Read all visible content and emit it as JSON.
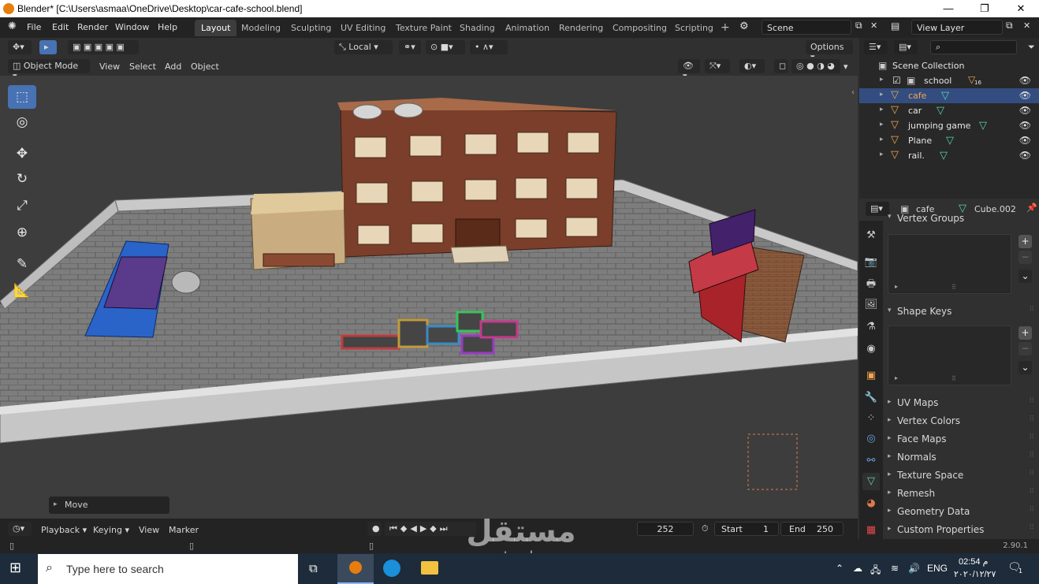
{
  "window": {
    "title": "Blender* [C:\\Users\\asmaa\\OneDrive\\Desktop\\car-cafe-school.blend]",
    "minimize": "—",
    "restore": "❐",
    "close": "✕"
  },
  "menu": {
    "items": [
      "File",
      "Edit",
      "Render",
      "Window",
      "Help"
    ]
  },
  "workspaces": {
    "tabs": [
      "Layout",
      "Modeling",
      "Sculpting",
      "UV Editing",
      "Texture Paint",
      "Shading",
      "Animation",
      "Rendering",
      "Compositing",
      "Scripting"
    ],
    "active": "Layout",
    "add": "+"
  },
  "scene": {
    "scene_name": "Scene",
    "view_layer": "View Layer"
  },
  "viewport_header": {
    "transform_orientation": "Local",
    "options": "Options",
    "mode": "Object Mode",
    "menus": [
      "View",
      "Select",
      "Add",
      "Object"
    ]
  },
  "operator_panel": {
    "label": "Move"
  },
  "timeline": {
    "menus": [
      "Playback",
      "Keying",
      "View",
      "Marker"
    ],
    "current_frame": "252",
    "start_label": "Start",
    "start_value": "1",
    "end_label": "End",
    "end_value": "250"
  },
  "outliner": {
    "header": "Scene Collection",
    "rows": [
      {
        "name": "school",
        "badge": "16",
        "selected": false
      },
      {
        "name": "cafe",
        "selected": true
      },
      {
        "name": "car",
        "selected": false
      },
      {
        "name": "jumping game",
        "selected": false
      },
      {
        "name": "Plane",
        "selected": false
      },
      {
        "name": "rail.",
        "selected": false
      }
    ]
  },
  "properties": {
    "object_name": "cafe",
    "mesh_name": "Cube.002",
    "vertex_groups": "Vertex Groups",
    "shape_keys": "Shape Keys",
    "panels": [
      "UV Maps",
      "Vertex Colors",
      "Face Maps",
      "Normals",
      "Texture Space",
      "Remesh",
      "Geometry Data",
      "Custom Properties"
    ]
  },
  "status": {
    "version": "2.90.1"
  },
  "taskbar": {
    "search_placeholder": "Type here to search",
    "language": "ENG",
    "time": "02:54 م",
    "date": "٢٠٢٠/١٢/٢٧",
    "notification_count": "1"
  },
  "watermark": {
    "arabic": "مستقل",
    "domain": "mostaql.com"
  },
  "colors": {
    "accent": "#4772b3",
    "selection": "#334d80",
    "object_orange": "#f3a64d",
    "mesh_green": "#5fd0b8"
  }
}
